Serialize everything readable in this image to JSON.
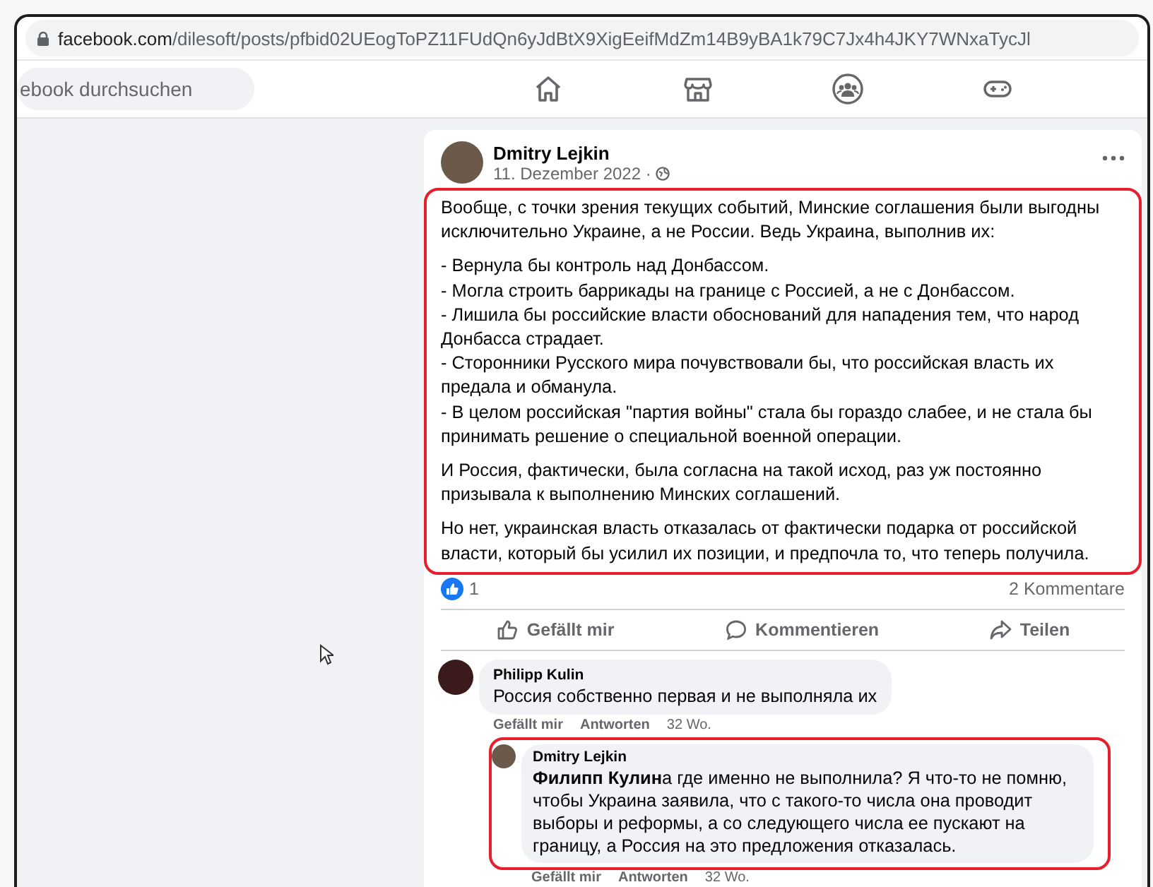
{
  "browser": {
    "url_host": "facebook.com",
    "url_path": "/dilesoft/posts/pfbid02UEogToPZ11FUdQn6yJdBtX9XigEeifMdZm14B9yBA1k79C7Jx4h4JKY7WNxaTycJl"
  },
  "nav": {
    "search_placeholder": "ebook durchsuchen"
  },
  "post": {
    "author": "Dmitry Lejkin",
    "date": "11. Dezember 2022 ·",
    "highlighted": true,
    "paragraphs": [
      {
        "lines": [
          "Вообще, с точки зрения текущих событий, Минские соглашения были выгодны исключительно Украине, а не России. Ведь Украина, выполнив их:"
        ]
      },
      {
        "lines": [
          "- Вернула бы контроль над Донбассом.",
          "- Могла строить баррикады на границе с Россией, а не с Донбассом.",
          "- Лишила бы российские власти обоснований для нападения тем, что народ Донбасса страдает.",
          "- Сторонники Русского мира почувствовали бы, что российская власть их предала и обманула.",
          "- В целом российская \"партия войны\" стала бы гораздо слабее, и не стала бы принимать решение о специальной военной операции."
        ]
      },
      {
        "lines": [
          "И Россия, фактически, была согласна на такой исход, раз уж постоянно призывала к выполнению Минских соглашений."
        ]
      },
      {
        "lines": [
          "Но нет, украинская власть отказалась от фактически подарка от российской власти, который бы усилил их позиции, и предпочла то, что теперь получила."
        ]
      }
    ],
    "reaction_count": "1",
    "comment_count": "2 Kommentare",
    "actions": [
      {
        "kind": "like",
        "label": "Gefällt mir"
      },
      {
        "kind": "comment",
        "label": "Kommentieren"
      },
      {
        "kind": "share",
        "label": "Teilen"
      }
    ]
  },
  "comments": [
    {
      "author": "Philipp Kulin",
      "text": "Россия собственно первая и не выполняла их",
      "highlighted": false,
      "actions": [
        "Gefällt mir",
        "Antworten"
      ],
      "time": "32 Wo.",
      "replies": [
        {
          "author": "Dmitry Lejkin",
          "text": "**Филипп Кулин**а где именно не выполнила? Я что-то не помню, чтобы Украина заявила, что с такого-то числа она проводит выборы и реформы, а со следующего числа ее пускают на границу, а Россия на это предложения отказалась.",
          "highlighted": true,
          "actions": [
            "Gefällt mir",
            "Antworten"
          ],
          "time": "32 Wo."
        }
      ]
    }
  ]
}
